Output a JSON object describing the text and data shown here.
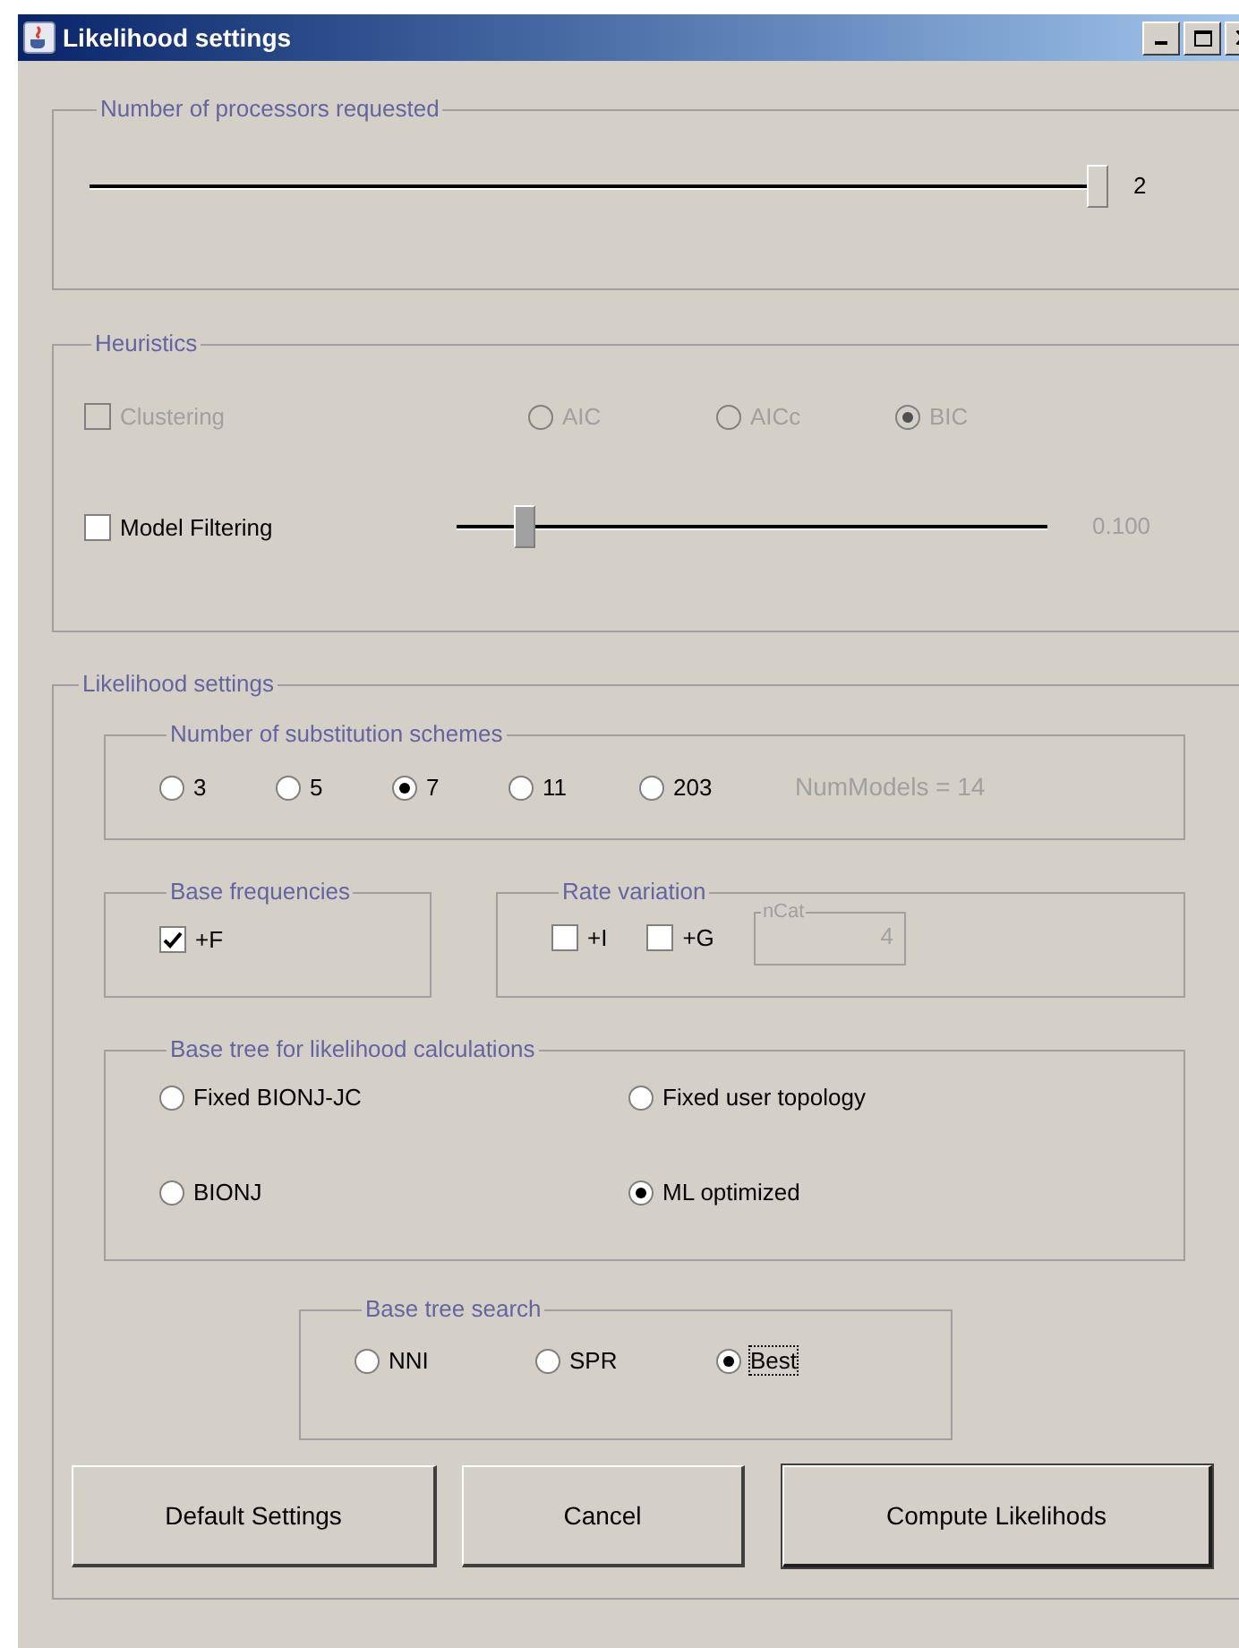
{
  "window": {
    "title": "Likelihood settings"
  },
  "processors": {
    "title": "Number of processors requested",
    "level": 1,
    "reading": "2"
  },
  "heuristics": {
    "title": "Heuristics",
    "clustering": {
      "label": "Clustering",
      "checked": false,
      "disabled": true
    },
    "criteria": [
      {
        "label": "AIC",
        "selected": false,
        "disabled": true
      },
      {
        "label": "AICc",
        "selected": false,
        "disabled": true
      },
      {
        "label": "BIC",
        "selected": true,
        "disabled": true
      }
    ],
    "model_filtering": {
      "label": "Model Filtering",
      "checked": false,
      "disabled": false
    },
    "filter_slider": {
      "level": 0.1,
      "reading": "0.100",
      "disabled": true
    }
  },
  "likelihood": {
    "title": "Likelihood settings",
    "schemes": {
      "title": "Number of substitution schemes",
      "options": [
        {
          "label": "3",
          "selected": false
        },
        {
          "label": "5",
          "selected": false
        },
        {
          "label": "7",
          "selected": true
        },
        {
          "label": "11",
          "selected": false
        },
        {
          "label": "203",
          "selected": false
        }
      ],
      "num_models": "NumModels = 14"
    },
    "base_frequencies": {
      "title": "Base frequencies",
      "options": [
        {
          "label": "+F",
          "checked": true
        }
      ]
    },
    "rate_variation": {
      "title": "Rate variation",
      "options": [
        {
          "label": "+I",
          "checked": false
        },
        {
          "label": "+G",
          "checked": false
        }
      ],
      "ncat": {
        "label": "nCat",
        "value": "4",
        "disabled": true
      }
    },
    "base_tree": {
      "title": "Base tree for likelihood calculations",
      "options": [
        {
          "label": "Fixed BIONJ-JC",
          "selected": false
        },
        {
          "label": "Fixed user topology",
          "selected": false
        },
        {
          "label": "BIONJ",
          "selected": false
        },
        {
          "label": "ML optimized",
          "selected": true
        }
      ]
    },
    "tree_search": {
      "title": "Base tree search",
      "options": [
        {
          "label": "NNI",
          "selected": false,
          "focused": false
        },
        {
          "label": "SPR",
          "selected": false,
          "focused": false
        },
        {
          "label": "Best",
          "selected": true,
          "focused": true
        }
      ]
    }
  },
  "buttons": [
    {
      "label": "Default Settings",
      "default": false
    },
    {
      "label": "Cancel",
      "default": false
    },
    {
      "label": "Compute Likelihods",
      "default": true
    }
  ]
}
